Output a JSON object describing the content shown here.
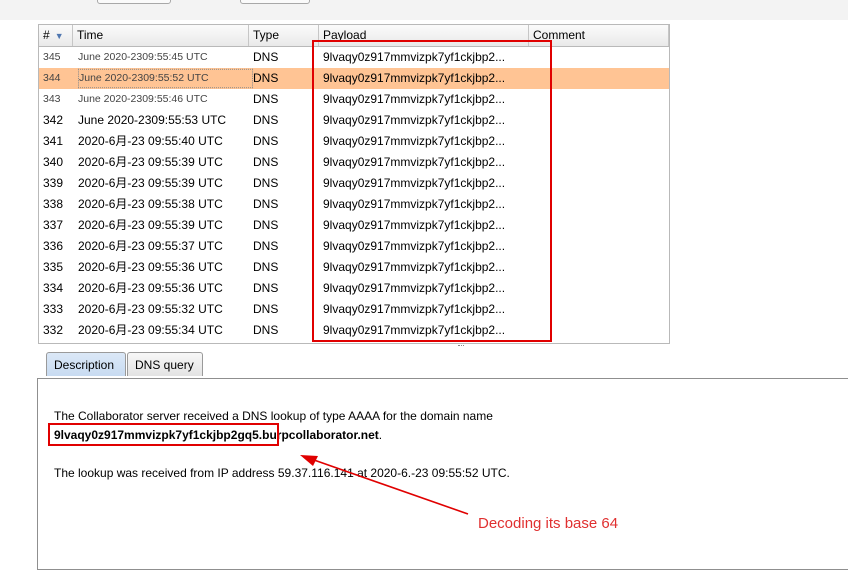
{
  "table": {
    "columns": {
      "num": "#",
      "time": "Time",
      "type": "Type",
      "payload": "Payload",
      "comment": "Comment"
    },
    "rows": [
      {
        "num": "345",
        "time": "June 2020-2309:55:45 UTC",
        "type": "DNS",
        "payload": "9lvaqy0z917mmvizpk7yf1ckjbp2...",
        "comment": ""
      },
      {
        "num": "344",
        "time": "June 2020-2309:55:52 UTC",
        "type": "DNS",
        "payload": "9lvaqy0z917mmvizpk7yf1ckjbp2...",
        "comment": ""
      },
      {
        "num": "343",
        "time": "June 2020-2309:55:46 UTC",
        "type": "DNS",
        "payload": "9lvaqy0z917mmvizpk7yf1ckjbp2...",
        "comment": ""
      },
      {
        "num": "342",
        "time": "June 2020-2309:55:53 UTC",
        "type": "DNS",
        "payload": "9lvaqy0z917mmvizpk7yf1ckjbp2...",
        "comment": ""
      },
      {
        "num": "341",
        "time": "2020-6月-23 09:55:40 UTC",
        "type": "DNS",
        "payload": "9lvaqy0z917mmvizpk7yf1ckjbp2...",
        "comment": ""
      },
      {
        "num": "340",
        "time": "2020-6月-23 09:55:39 UTC",
        "type": "DNS",
        "payload": "9lvaqy0z917mmvizpk7yf1ckjbp2...",
        "comment": ""
      },
      {
        "num": "339",
        "time": "2020-6月-23 09:55:39 UTC",
        "type": "DNS",
        "payload": "9lvaqy0z917mmvizpk7yf1ckjbp2...",
        "comment": ""
      },
      {
        "num": "338",
        "time": "2020-6月-23 09:55:38 UTC",
        "type": "DNS",
        "payload": "9lvaqy0z917mmvizpk7yf1ckjbp2...",
        "comment": ""
      },
      {
        "num": "337",
        "time": "2020-6月-23 09:55:39 UTC",
        "type": "DNS",
        "payload": "9lvaqy0z917mmvizpk7yf1ckjbp2...",
        "comment": ""
      },
      {
        "num": "336",
        "time": "2020-6月-23 09:55:37 UTC",
        "type": "DNS",
        "payload": "9lvaqy0z917mmvizpk7yf1ckjbp2...",
        "comment": ""
      },
      {
        "num": "335",
        "time": "2020-6月-23 09:55:36 UTC",
        "type": "DNS",
        "payload": "9lvaqy0z917mmvizpk7yf1ckjbp2...",
        "comment": ""
      },
      {
        "num": "334",
        "time": "2020-6月-23 09:55:36 UTC",
        "type": "DNS",
        "payload": "9lvaqy0z917mmvizpk7yf1ckjbp2...",
        "comment": ""
      },
      {
        "num": "333",
        "time": "2020-6月-23 09:55:32 UTC",
        "type": "DNS",
        "payload": "9lvaqy0z917mmvizpk7yf1ckjbp2...",
        "comment": ""
      },
      {
        "num": "332",
        "time": "2020-6月-23 09:55:34 UTC",
        "type": "DNS",
        "payload": "9lvaqy0z917mmvizpk7yf1ckjbp2...",
        "comment": ""
      }
    ]
  },
  "tabs": [
    {
      "label": "Description"
    },
    {
      "label": "DNS query"
    }
  ],
  "description": {
    "line1": "The Collaborator server received a DNS lookup of type AAAA for the domain name",
    "domain_bold": "9lvaqy0z917mmvizpk7yf1ckjbp2gq5.burpcollaborator.net",
    "domain_suffix": ".",
    "line3": "The lookup was received from IP address 59.37.116.141 at 2020-6.-23 09:55:52 UTC."
  },
  "annotation": {
    "label": "Decoding its base 64"
  },
  "colors": {
    "selected_row": "#ffc494",
    "annotation_red": "#e00000",
    "tab_active": "#c8dbf1"
  },
  "icons": {
    "sort": "sort-down-triangle-icon"
  }
}
